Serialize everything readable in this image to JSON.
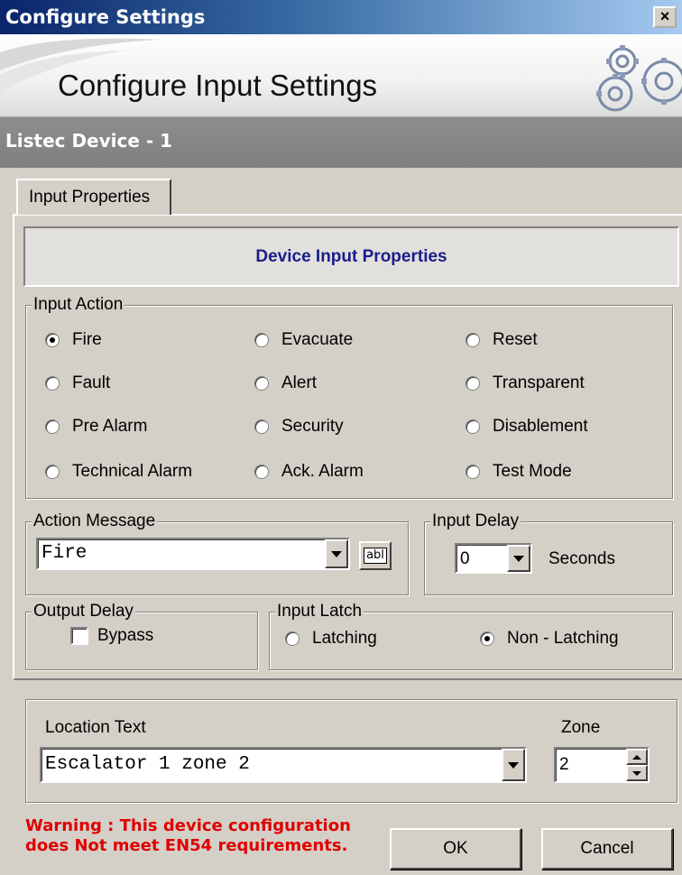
{
  "window": {
    "title": "Configure Settings",
    "close_glyph": "×"
  },
  "banner": {
    "heading": "Configure Input Settings",
    "logo_icon": "gears-icon"
  },
  "device": {
    "name": "Listec Device - 1"
  },
  "tabs": [
    {
      "label": "Input Properties"
    }
  ],
  "properties_banner": {
    "title": "Device Input Properties",
    "color": "#1c1c8a"
  },
  "input_action": {
    "legend": "Input Action",
    "options": [
      {
        "label": "Fire",
        "selected": true
      },
      {
        "label": "Evacuate",
        "selected": false
      },
      {
        "label": "Reset",
        "selected": false
      },
      {
        "label": "Fault",
        "selected": false
      },
      {
        "label": "Alert",
        "selected": false
      },
      {
        "label": "Transparent",
        "selected": false
      },
      {
        "label": "Pre Alarm",
        "selected": false
      },
      {
        "label": "Security",
        "selected": false
      },
      {
        "label": "Disablement",
        "selected": false
      },
      {
        "label": "Technical Alarm",
        "selected": false
      },
      {
        "label": "Ack. Alarm",
        "selected": false
      },
      {
        "label": "Test Mode",
        "selected": false
      }
    ]
  },
  "action_message": {
    "legend": "Action Message",
    "value": "Fire",
    "edit_icon_label": "abl"
  },
  "input_delay": {
    "legend": "Input Delay",
    "value": "0",
    "unit": "Seconds"
  },
  "output_delay": {
    "legend": "Output Delay",
    "bypass_label": "Bypass",
    "bypass_checked": false
  },
  "input_latch": {
    "legend": "Input Latch",
    "options": [
      {
        "label": "Latching",
        "selected": false
      },
      {
        "label": "Non - Latching",
        "selected": true
      }
    ]
  },
  "location": {
    "label": "Location Text",
    "value": "Escalator 1 zone 2"
  },
  "zone": {
    "label": "Zone",
    "value": "2"
  },
  "warning": {
    "line1": "Warning : This device configuration",
    "line2": "does Not meet EN54 requirements.",
    "color": "#e00000"
  },
  "buttons": {
    "ok": "OK",
    "cancel": "Cancel"
  }
}
